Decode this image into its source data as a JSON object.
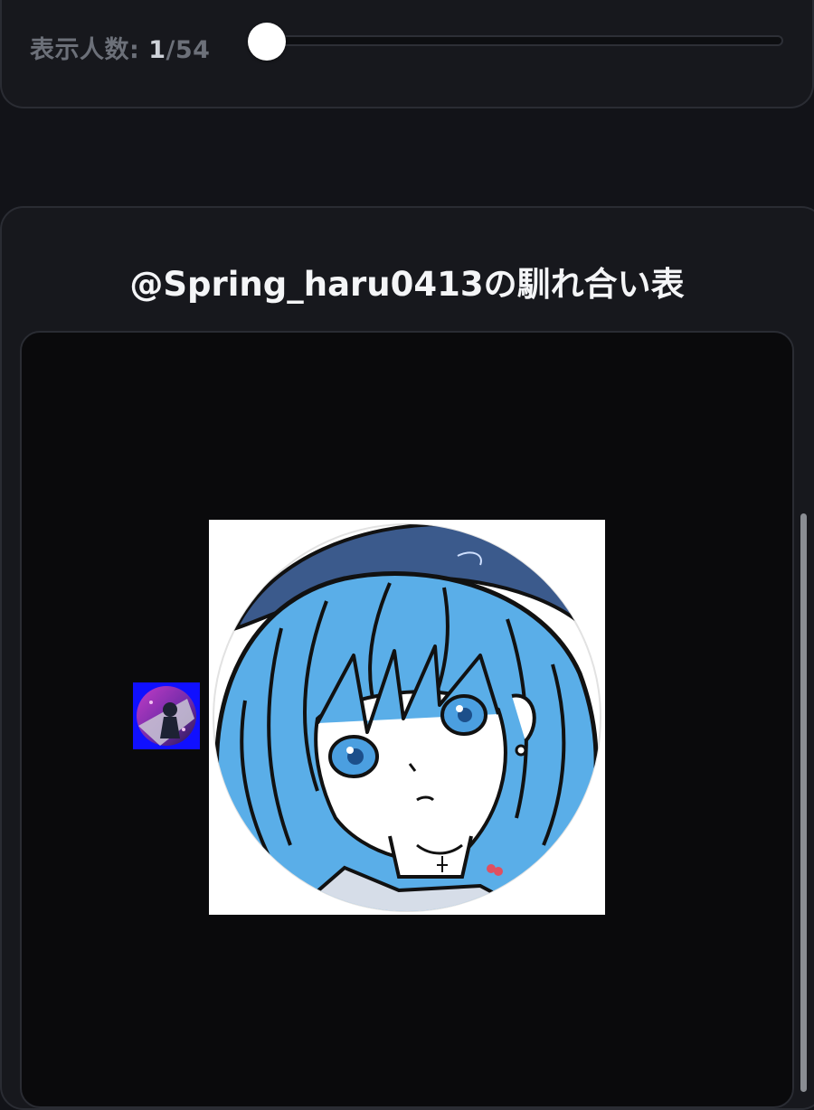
{
  "header": {
    "count_label": "表示人数:",
    "count_current": "1",
    "count_total": "/54",
    "slider_value": 1,
    "slider_max": 54
  },
  "main": {
    "title": "@Spring_haru0413の馴れ合い表"
  },
  "colors": {
    "background": "#121318",
    "card": "#17181d",
    "chart_background": "#0a0a0c",
    "small_avatar_bg": "#1010ff",
    "accent_blue": "#5aaee8"
  }
}
